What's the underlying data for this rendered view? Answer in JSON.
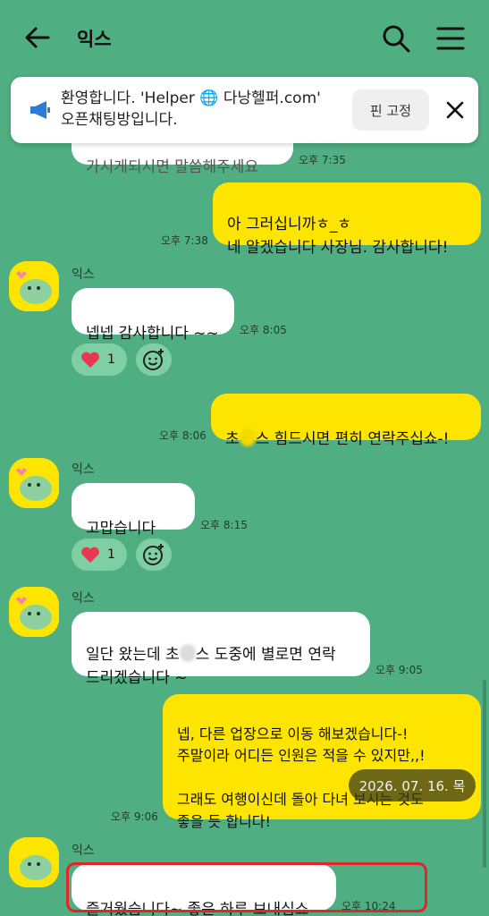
{
  "header": {
    "title": "익스"
  },
  "notice": {
    "text_line1": "환영합니다. 'Helper 🌐 다낭헬퍼.com'",
    "text_line2": "오픈채팅방입니다.",
    "pin_label": "핀 고정"
  },
  "messages": {
    "m0": {
      "partial_text": "가시게되시면 말씀해주세요",
      "time": "오후 7:35"
    },
    "m1": {
      "text": "아 그러십니까ㅎ_ㅎ\n네 알겠습니다 사장님. 감사합니다!",
      "time": "오후 7:38"
    },
    "m2": {
      "sender": "익스",
      "text": "넵넵 감사합니다 ~~",
      "time": "오후 8:05",
      "reaction_count": "1"
    },
    "m3": {
      "text_before": "초",
      "text_after": "스 힘드시면 편히 연락주십쇼-!",
      "time": "오후 8:06"
    },
    "m4": {
      "sender": "익스",
      "text": "고맙습니다~~",
      "time": "오후 8:15",
      "reaction_count": "1"
    },
    "m5": {
      "sender": "익스",
      "text_before": "일단 왔는데 초",
      "text_after": "스 도중에 별로면 연락\n드리겠습니다 ~",
      "time": "오후 9:05"
    },
    "m6": {
      "text": "넵, 다른 업장으로 이동 해보겠습니다-!\n주말이라 어디든 인원은 적을 수 있지만,,!\n\n그래도 여행이신데 돌아 다녀 보시는 것도\n좋을 듯 합니다!",
      "time": "오후 9:06"
    },
    "m7": {
      "sender": "익스",
      "text": "즐거웠습니다~ 좋은 하루 보내십쇼",
      "time": "오후 10:24"
    }
  },
  "date_overlay": "2026. 07. 16. 목",
  "colors": {
    "background": "#4fae82",
    "my_bubble": "#fee500",
    "other_bubble": "#ffffff",
    "highlight": "#e0252b"
  },
  "icons": [
    "back-arrow-icon",
    "search-icon",
    "menu-icon",
    "megaphone-icon",
    "close-icon",
    "heart-icon",
    "add-emoji-icon"
  ]
}
